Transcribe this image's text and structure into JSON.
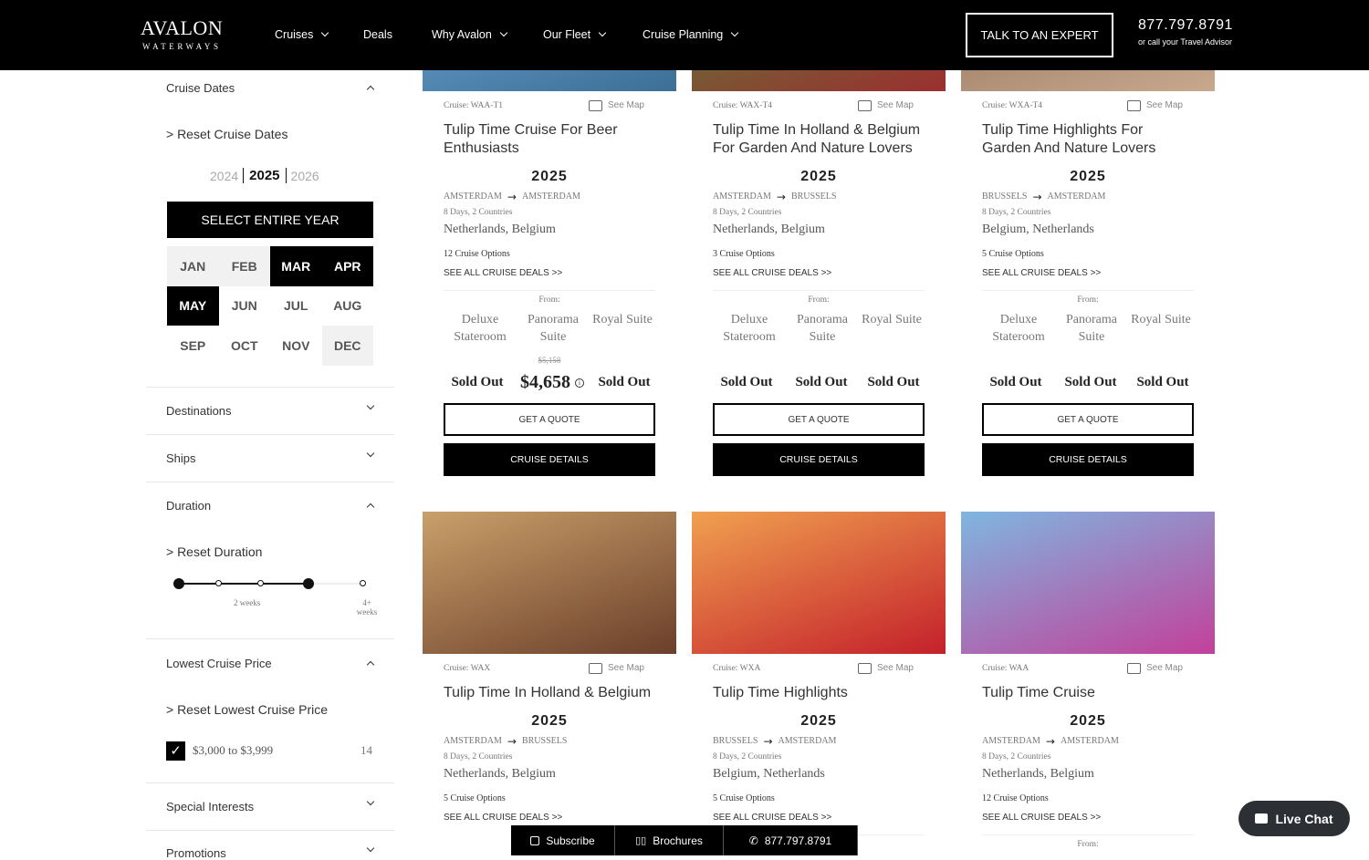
{
  "header": {
    "logo_main": "AVALON",
    "logo_sub": "WATERWAYS",
    "nav": [
      {
        "label": "Cruises",
        "dropdown": true
      },
      {
        "label": "Deals",
        "dropdown": false
      },
      {
        "label": "Why Avalon",
        "dropdown": true
      },
      {
        "label": "Our Fleet",
        "dropdown": true
      },
      {
        "label": "Cruise Planning",
        "dropdown": true
      }
    ],
    "cta": "TALK TO AN EXPERT",
    "phone": "877.797.8791",
    "phone_sub": "or call your Travel Advisor"
  },
  "sidebar": {
    "cruise_dates": {
      "title": "Cruise Dates",
      "reset": "> Reset Cruise Dates",
      "years": [
        "2024",
        "2025",
        "2026"
      ],
      "selected_year": "2025",
      "select_year": "SELECT ENTIRE YEAR",
      "months": [
        {
          "label": "JAN",
          "state": "unavailable"
        },
        {
          "label": "FEB",
          "state": "unavailable"
        },
        {
          "label": "MAR",
          "state": "selected"
        },
        {
          "label": "APR",
          "state": "selected"
        },
        {
          "label": "MAY",
          "state": "selected"
        },
        {
          "label": "JUN",
          "state": "available"
        },
        {
          "label": "JUL",
          "state": "available"
        },
        {
          "label": "AUG",
          "state": "available"
        },
        {
          "label": "SEP",
          "state": "available"
        },
        {
          "label": "OCT",
          "state": "available"
        },
        {
          "label": "NOV",
          "state": "available"
        },
        {
          "label": "DEC",
          "state": "unavailable"
        }
      ]
    },
    "destinations": "Destinations",
    "ships": "Ships",
    "duration": {
      "title": "Duration",
      "reset": "> Reset Duration",
      "label_mid": "2 weeks",
      "label_max": "4+ weeks",
      "range_selected_steps": [
        0,
        3
      ],
      "steps": 5
    },
    "price": {
      "title": "Lowest Cruise Price",
      "reset": "> Reset Lowest Cruise Price",
      "option": "$3,000 to $3,999",
      "count": "14",
      "checked": true
    },
    "special_interests": "Special Interests",
    "promotions": "Promotions"
  },
  "cards": [
    {
      "code": "Cruise: WAA-T1",
      "see_map": "See Map",
      "title": "Tulip Time Cruise For Beer Enthusiasts",
      "year": "2025",
      "from_city": "AMSTERDAM",
      "to_city": "AMSTERDAM",
      "days": "8 Days, 2 Countries",
      "countries": "Netherlands, Belgium",
      "options": "12 Cruise Options",
      "deals": "SEE ALL CRUISE DEALS >>",
      "from": "From:",
      "cabins": [
        "Deluxe Stateroom",
        "Panorama Suite",
        "Royal Suite"
      ],
      "original_price": "$5,158",
      "prices": [
        "Sold Out",
        "$4,658",
        "Sold Out"
      ],
      "quote": "GET A QUOTE",
      "details": "CRUISE DETAILS",
      "img": [
        "#6fa8d8",
        "#3d6f96"
      ]
    },
    {
      "code": "Cruise: WAX-T4",
      "see_map": "See Map",
      "title": "Tulip Time In Holland & Belgium For Garden And Nature Lovers",
      "year": "2025",
      "from_city": "AMSTERDAM",
      "to_city": "BRUSSELS",
      "days": "8 Days, 2 Countries",
      "countries": "Netherlands, Belgium",
      "options": "3 Cruise Options",
      "deals": "SEE ALL CRUISE DEALS >>",
      "from": "From:",
      "cabins": [
        "Deluxe Stateroom",
        "Panorama Suite",
        "Royal Suite"
      ],
      "original_price": "",
      "prices": [
        "Sold Out",
        "Sold Out",
        "Sold Out"
      ],
      "quote": "GET A QUOTE",
      "details": "CRUISE DETAILS",
      "img": [
        "#4f8a3a",
        "#9b2f2f"
      ]
    },
    {
      "code": "Cruise: WXA-T4",
      "see_map": "See Map",
      "title": "Tulip Time Highlights For Garden And Nature Lovers",
      "year": "2025",
      "from_city": "BRUSSELS",
      "to_city": "AMSTERDAM",
      "days": "8 Days, 2 Countries",
      "countries": "Belgium, Netherlands",
      "options": "5 Cruise Options",
      "deals": "SEE ALL CRUISE DEALS >>",
      "from": "From:",
      "cabins": [
        "Deluxe Stateroom",
        "Panorama Suite",
        "Royal Suite"
      ],
      "original_price": "",
      "prices": [
        "Sold Out",
        "Sold Out",
        "Sold Out"
      ],
      "quote": "GET A QUOTE",
      "details": "CRUISE DETAILS",
      "img": [
        "#8a6a52",
        "#c9a98e"
      ]
    },
    {
      "code": "Cruise: WAX",
      "see_map": "See Map",
      "title": "Tulip Time In Holland & Belgium",
      "year": "2025",
      "from_city": "AMSTERDAM",
      "to_city": "BRUSSELS",
      "days": "8 Days, 2 Countries",
      "countries": "Netherlands, Belgium",
      "options": "5 Cruise Options",
      "deals": "SEE ALL CRUISE DEALS >>",
      "img": [
        "#c9a06a",
        "#6b3f2a"
      ]
    },
    {
      "code": "Cruise: WXA",
      "see_map": "See Map",
      "title": "Tulip Time Highlights",
      "year": "2025",
      "from_city": "BRUSSELS",
      "to_city": "AMSTERDAM",
      "days": "8 Days, 2 Countries",
      "countries": "Belgium, Netherlands",
      "options": "5 Cruise Options",
      "deals": "SEE ALL CRUISE DEALS >>",
      "from": "From:",
      "img": [
        "#f0a050",
        "#c4202a"
      ]
    },
    {
      "code": "Cruise: WAA",
      "see_map": "See Map",
      "title": "Tulip Time Cruise",
      "year": "2025",
      "from_city": "AMSTERDAM",
      "to_city": "AMSTERDAM",
      "days": "8 Days, 2 Countries",
      "countries": "Netherlands, Belgium",
      "options": "12 Cruise Options",
      "deals": "SEE ALL CRUISE DEALS >>",
      "from": "From:",
      "img": [
        "#7fb6e0",
        "#c2409a"
      ]
    }
  ],
  "bottom_bar": {
    "subscribe": "Subscribe",
    "brochures": "Brochures",
    "phone": "877.797.8791"
  },
  "live_chat": "Live Chat"
}
